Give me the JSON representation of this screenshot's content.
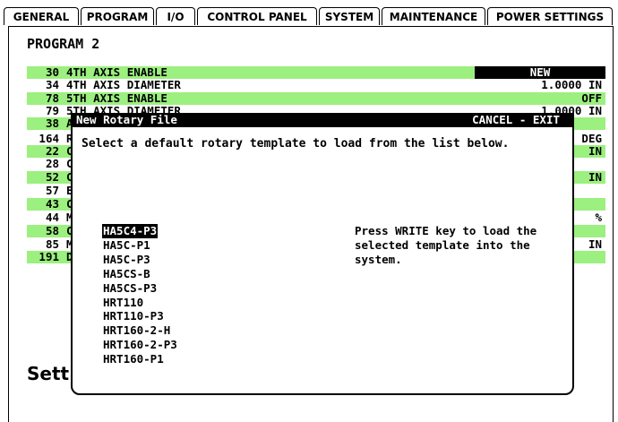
{
  "tabs": [
    "GENERAL",
    "PROGRAM",
    "I/O",
    "CONTROL PANEL",
    "SYSTEM",
    "MAINTENANCE",
    "POWER SETTINGS"
  ],
  "active_tab": "PROGRAM",
  "page_title": "PROGRAM 2",
  "settings_rows": [
    {
      "num": "30",
      "name": "4TH AXIS ENABLE",
      "value": "NEW",
      "green": true
    },
    {
      "num": "34",
      "name": "4TH AXIS DIAMETER",
      "value": "1.0000 IN",
      "green": false
    },
    {
      "num": "78",
      "name": "5TH AXIS ENABLE",
      "value": "OFF",
      "green": true
    },
    {
      "num": "79",
      "name": "5TH AXIS DIAMETER",
      "value": "1.0000 IN",
      "green": false
    },
    {
      "num": "38",
      "name": "A",
      "value": "",
      "green": true
    },
    {
      "num": "164",
      "name": "R",
      "value": "DEG",
      "green": false
    },
    {
      "num": "22",
      "name": "C",
      "value": "IN",
      "green": true
    },
    {
      "num": "28",
      "name": "C",
      "value": "",
      "green": false
    },
    {
      "num": "52",
      "name": "C",
      "value": "IN",
      "green": true
    },
    {
      "num": "57",
      "name": "E",
      "value": "",
      "green": false
    },
    {
      "num": "43",
      "name": "C",
      "value": "",
      "green": true
    },
    {
      "num": "44",
      "name": "M",
      "value": "%",
      "green": false
    },
    {
      "num": "58",
      "name": "C",
      "value": "",
      "green": true
    },
    {
      "num": "85",
      "name": "M",
      "value": "IN",
      "green": false
    },
    {
      "num": "191",
      "name": "D",
      "value": "",
      "green": true
    }
  ],
  "settings_label": "Sett",
  "dialog": {
    "title": "New Rotary File",
    "cancel": "CANCEL - EXIT",
    "message": "Select a default rotary template to load from the list below.",
    "items": [
      "HA5C4-P3",
      "HA5C-P1",
      "HA5C-P3",
      "HA5CS-B",
      "HA5CS-P3",
      "HRT110",
      "HRT110-P3",
      "HRT160-2-H",
      "HRT160-2-P3",
      "HRT160-P1"
    ],
    "selected_index": 0,
    "hint": "Press WRITE key to load the selected template into the system."
  },
  "colors": {
    "row_green": "#9bf07f",
    "selection": "#000000"
  }
}
